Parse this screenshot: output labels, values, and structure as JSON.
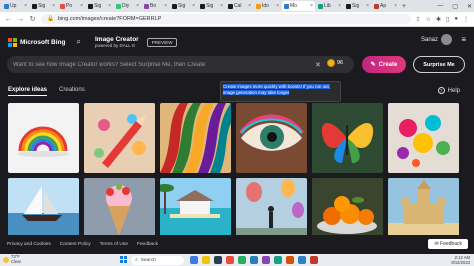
{
  "browser": {
    "tabs": [
      {
        "label": "Up",
        "fav": "#2a7bd4"
      },
      {
        "label": "Sig",
        "fav": "#1b1a1f"
      },
      {
        "label": "Po",
        "fav": "#e74c3c"
      },
      {
        "label": "Sig",
        "fav": "#1b1a1f"
      },
      {
        "label": "Diy",
        "fav": "#2ecc71"
      },
      {
        "label": "Bo",
        "fav": "#8e44ad"
      },
      {
        "label": "Sig",
        "fav": "#1b1a1f"
      },
      {
        "label": "Sig",
        "fav": "#1b1a1f"
      },
      {
        "label": "Cal",
        "fav": "#1b1a1f"
      },
      {
        "label": "Ido",
        "fav": "#f39c12"
      },
      {
        "label": "Mo",
        "fav": "#2a7bd4",
        "active": true
      },
      {
        "label": "Lib",
        "fav": "#16a085"
      },
      {
        "label": "Sig",
        "fav": "#1b1a1f"
      },
      {
        "label": "Ap",
        "fav": "#c0392b"
      }
    ],
    "new_tab": "+",
    "url": "bing.com/images/create?FORM=GERRLP"
  },
  "header": {
    "brand": "Microsoft Bing",
    "product_title": "Image Creator",
    "product_subtitle": "powered by DALL·E",
    "preview_badge": "PREVIEW",
    "user_name": "Sanaz",
    "ms_colors": [
      "#f25022",
      "#7fba00",
      "#00a4ef",
      "#ffb900"
    ]
  },
  "prompt": {
    "placeholder": "Want to see how Image Creator works? Select Surprise Me, then Create",
    "boosts": "96",
    "create_label": "Create",
    "surprise_label": "Surprise Me"
  },
  "tooltip": {
    "line1": "Create images more quickly with boosts! If you run out,",
    "line2": "image generation may take longer"
  },
  "tabs": {
    "explore": "Explore ideas",
    "creations": "Creations",
    "help": "Help"
  },
  "gallery": [
    {
      "name": "rainbow-tile",
      "bg": "#f4f4f4"
    },
    {
      "name": "pencil-tile",
      "bg": "#cfae8f"
    },
    {
      "name": "ribbons-tile",
      "bg": "#d1a873"
    },
    {
      "name": "eye-tile",
      "bg": "#5a3826"
    },
    {
      "name": "butterfly-tile",
      "bg": "#3f5a3a"
    },
    {
      "name": "paint-splash-tile",
      "bg": "#d9d2cb"
    },
    {
      "name": "sailboat-tile",
      "bg": "#9fc3dd"
    },
    {
      "name": "ice-cream-tile",
      "bg": "#7e8a98"
    },
    {
      "name": "beach-house-tile",
      "bg": "#7fbde3"
    },
    {
      "name": "balloons-tile",
      "bg": "#a3bfd0"
    },
    {
      "name": "oranges-tile",
      "bg": "#3e4a33"
    },
    {
      "name": "sandcastle-tile",
      "bg": "#8ab7d6"
    }
  ],
  "footer": {
    "links": [
      "Privacy and Cookies",
      "Content Policy",
      "Terms of Use",
      "Feedback"
    ],
    "feedback_button": "Feedback"
  },
  "taskbar": {
    "weather_temp": "73°F",
    "weather_desc": "Clear",
    "search_label": "Search",
    "time": "2:12 AM",
    "date": "8/12/2023"
  }
}
